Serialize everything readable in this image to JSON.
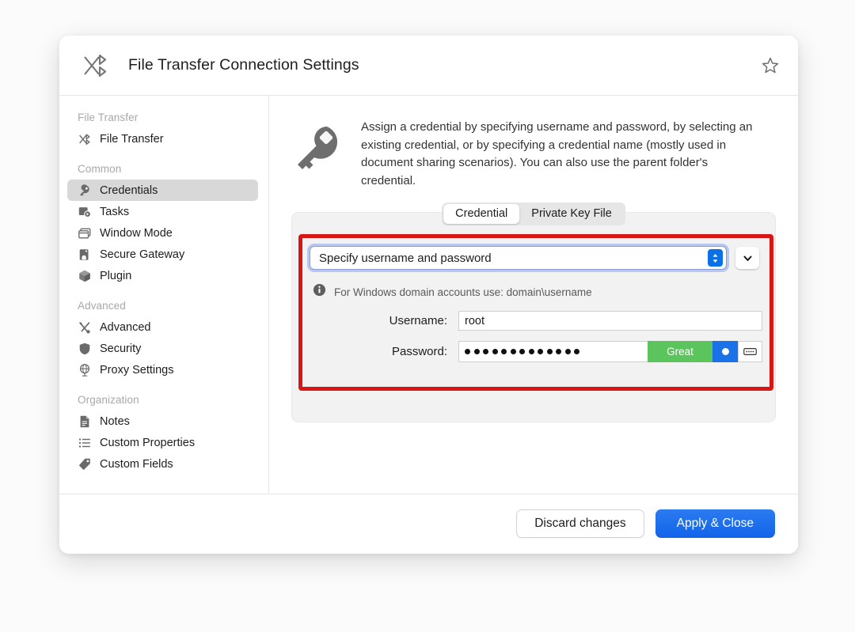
{
  "window": {
    "title": "File Transfer Connection Settings",
    "title_icon": "file-transfer-icon",
    "favorite_icon": "star-outline-icon"
  },
  "sidebar": {
    "groups": [
      {
        "title": "File Transfer",
        "items": [
          {
            "label": "File Transfer",
            "icon": "file-transfer-icon",
            "selected": false
          }
        ]
      },
      {
        "title": "Common",
        "items": [
          {
            "label": "Credentials",
            "icon": "key-icon",
            "selected": true
          },
          {
            "label": "Tasks",
            "icon": "tasks-icon",
            "selected": false
          },
          {
            "label": "Window Mode",
            "icon": "window-mode-icon",
            "selected": false
          },
          {
            "label": "Secure Gateway",
            "icon": "secure-gateway-icon",
            "selected": false
          },
          {
            "label": "Plugin",
            "icon": "plugin-cube-icon",
            "selected": false
          }
        ]
      },
      {
        "title": "Advanced",
        "items": [
          {
            "label": "Advanced",
            "icon": "tools-icon",
            "selected": false
          },
          {
            "label": "Security",
            "icon": "shield-icon",
            "selected": false
          },
          {
            "label": "Proxy Settings",
            "icon": "globe-icon",
            "selected": false
          }
        ]
      },
      {
        "title": "Organization",
        "items": [
          {
            "label": "Notes",
            "icon": "notes-icon",
            "selected": false
          },
          {
            "label": "Custom Properties",
            "icon": "list-icon",
            "selected": false
          },
          {
            "label": "Custom Fields",
            "icon": "tag-icon",
            "selected": false
          }
        ]
      }
    ]
  },
  "main": {
    "description": "Assign a credential by specifying username and password, by selecting an existing credential, or by specifying a credential name (mostly used in document sharing scenarios). You can also use the parent folder's credential.",
    "description_icon": "key-icon",
    "tabs": [
      {
        "label": "Credential",
        "active": true
      },
      {
        "label": "Private Key File",
        "active": false
      }
    ],
    "credential_mode": {
      "selected": "Specify username and password",
      "stepper_icon": "up-down-stepper-icon",
      "expand_icon": "chevron-down-icon"
    },
    "hint": {
      "icon": "info-icon",
      "text": "For Windows domain accounts use: domain\\username"
    },
    "fields": {
      "username_label": "Username:",
      "username_value": "root",
      "password_label": "Password:",
      "password_dot_count": 13,
      "password_strength": "Great",
      "reveal_icon": "blue-dot-icon",
      "keyboard_icon": "keyboard-icon"
    }
  },
  "footer": {
    "discard_label": "Discard changes",
    "apply_label": "Apply & Close"
  },
  "colors": {
    "accent_blue": "#1263e8",
    "strength_green": "#5cc45c",
    "annotation_red": "#d81616",
    "selected_nav": "#d8d8d8"
  }
}
